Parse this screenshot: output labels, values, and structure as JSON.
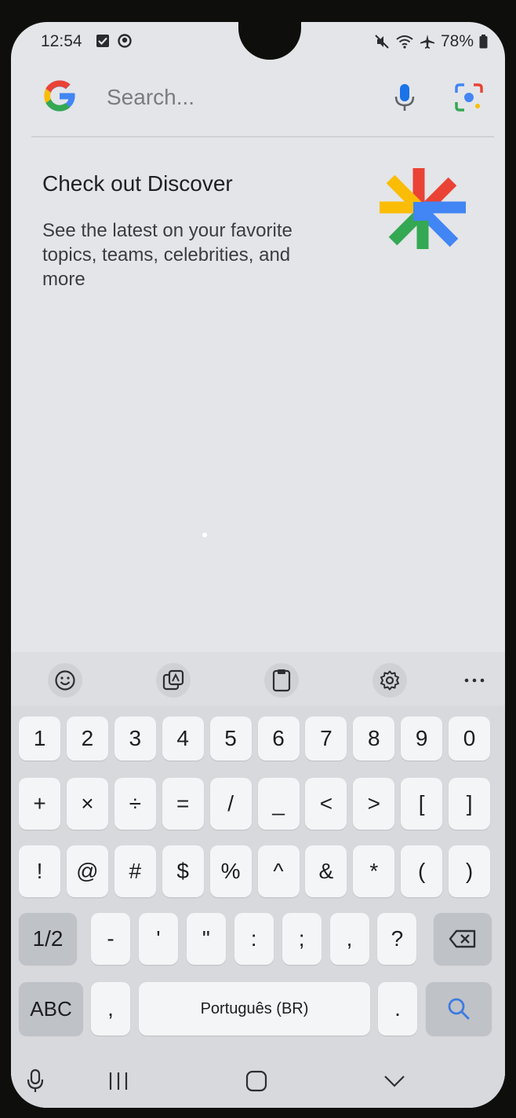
{
  "status_bar": {
    "time": "12:54",
    "battery": "78%"
  },
  "search": {
    "placeholder": "Search..."
  },
  "discover": {
    "title": "Check out Discover",
    "body": "See the latest on your favorite topics, teams, celebrities, and more"
  },
  "keyboard": {
    "toolbar": [
      "emoji-icon",
      "sticker-icon",
      "clipboard-icon",
      "settings-icon",
      "more-icon"
    ],
    "row1": [
      "1",
      "2",
      "3",
      "4",
      "5",
      "6",
      "7",
      "8",
      "9",
      "0"
    ],
    "row2": [
      "+",
      "×",
      "÷",
      "=",
      "/",
      "_",
      "<",
      ">",
      "[",
      "]"
    ],
    "row3": [
      "!",
      "@",
      "#",
      "$",
      "%",
      "^",
      "&",
      "*",
      "(",
      ")"
    ],
    "row4": [
      "1/2",
      "-",
      "'",
      "\"",
      ":",
      ";",
      ",",
      "?"
    ],
    "abc_label": "ABC",
    "comma": ",",
    "space_label": "Português (BR)",
    "period": "."
  },
  "colors": {
    "google_blue": "#4285F4",
    "google_red": "#EA4335",
    "google_yellow": "#FBBC05",
    "google_green": "#34A853",
    "accent_key": "#3f7be0"
  }
}
